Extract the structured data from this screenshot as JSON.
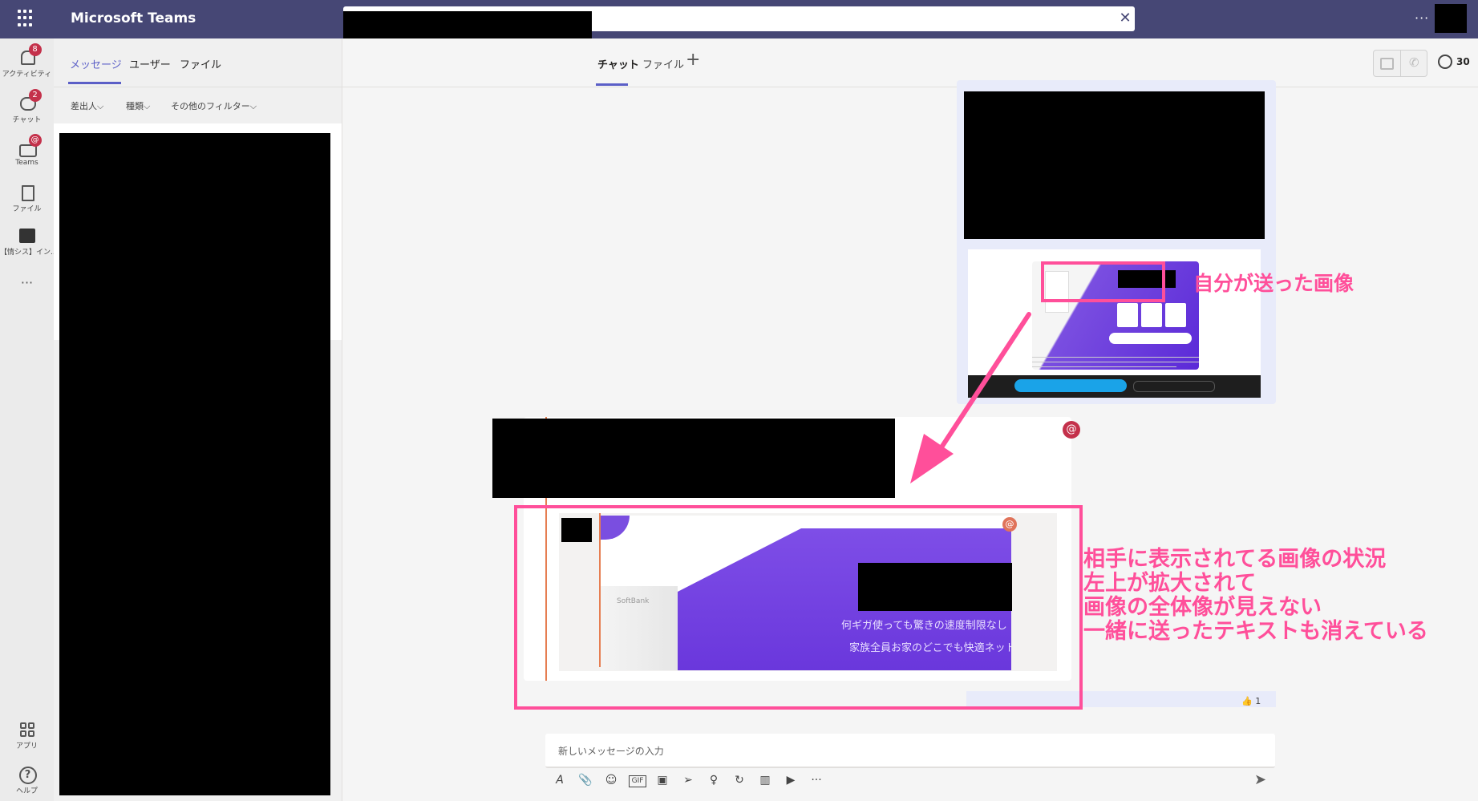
{
  "titlebar": {
    "app_title": "Microsoft Teams",
    "search_close": "✕",
    "more": "···"
  },
  "rail": {
    "items": [
      {
        "label": "アクティビティ",
        "badge": "8"
      },
      {
        "label": "チャット",
        "badge": "2"
      },
      {
        "label": "Teams",
        "badge": "@"
      },
      {
        "label": "ファイル"
      },
      {
        "label": "【情シス】イン..."
      },
      {
        "label": "···"
      }
    ],
    "bottom": [
      {
        "label": "アプリ"
      },
      {
        "label": "ヘルプ",
        "glyph": "?"
      }
    ]
  },
  "listpane": {
    "tabs": [
      "メッセージ",
      "ユーザー",
      "ファイル"
    ],
    "filters": [
      "差出人",
      "種類",
      "その他のフィルター"
    ],
    "chevron": "⌵"
  },
  "main": {
    "tabs": {
      "chat": "チャット",
      "files": "ファイル",
      "add": "+"
    },
    "people_count": "30",
    "phone": "✆"
  },
  "messages": {
    "other": {
      "mention": "@",
      "banner_brand": "SoftBank",
      "banner_line1": "何ギガ使っても驚きの速度制限なし",
      "banner_line2": "家族全員お家のどこでも快適ネット"
    },
    "reaction": "👍 1"
  },
  "compose": {
    "placeholder": "新しいメッセージの入力",
    "tools": [
      "A",
      "📎",
      "☺",
      "GIF",
      "▣",
      "➢",
      "♀",
      "↻",
      "▥",
      "▶",
      "···"
    ],
    "send": "➤"
  },
  "annotations": {
    "self_label": "自分が送った画像",
    "desc_lines": [
      "相手に表示されてる画像の状況",
      "左上が拡大されて",
      "画像の全体像が見えない",
      "一緒に送ったテキストも消えている"
    ],
    "color": "#ff4f9a"
  },
  "colors": {
    "titlebar": "#464775",
    "accent": "#5b5fc7",
    "badge": "#c4314b"
  }
}
